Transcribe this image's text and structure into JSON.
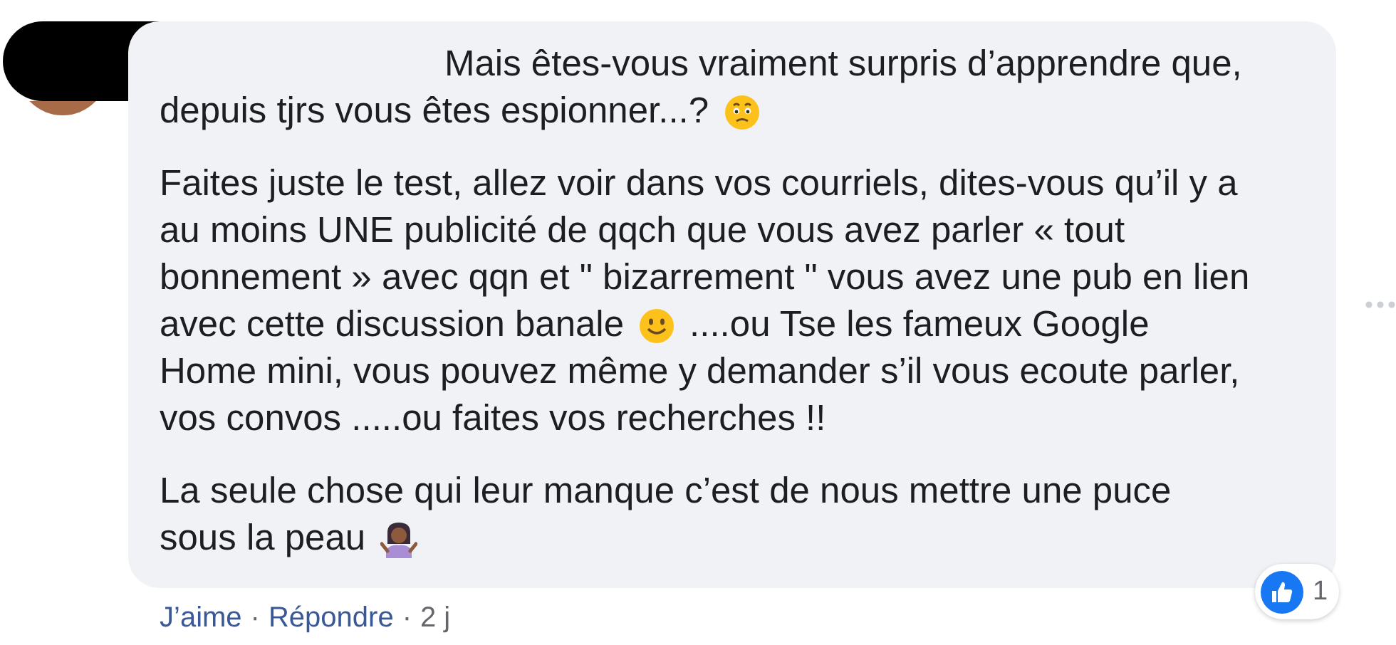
{
  "comment": {
    "paragraphs": [
      [
        [
          {
            "kind": "text",
            "text": "Mais êtes-vous vraiment surpris d’apprendre que,"
          }
        ],
        [
          {
            "kind": "text",
            "text": "depuis tjrs vous êtes espionner...?"
          },
          {
            "kind": "worried"
          }
        ]
      ],
      [
        [
          {
            "kind": "text",
            "text": "Faites juste le test, allez voir dans vos courriels, dites-vous qu’il y a"
          }
        ],
        [
          {
            "kind": "text",
            "text": "au moins UNE publicité de qqch que vous avez parler « tout"
          }
        ],
        [
          {
            "kind": "text",
            "text": "bonnement » avec qqn et \" bizarrement \" vous avez une pub en lien"
          }
        ],
        [
          {
            "kind": "text",
            "text": "avec cette discussion banale"
          },
          {
            "kind": "smiley"
          },
          {
            "kind": "text",
            "text": "....ou Tse les fameux Google"
          }
        ],
        [
          {
            "kind": "text",
            "text": "Home mini, vous pouvez même y demander s’il vous ecoute parler,"
          }
        ],
        [
          {
            "kind": "text",
            "text": "vos convos .....ou faites vos recherches !!"
          }
        ]
      ],
      [
        [
          {
            "kind": "text",
            "text": "La seule chose qui leur manque c’est de nous mettre une puce"
          }
        ],
        [
          {
            "kind": "text",
            "text": "sous la peau"
          },
          {
            "kind": "shrug"
          }
        ]
      ]
    ],
    "reaction_count": "1",
    "actions": [
      {
        "kind": "link",
        "text": "J’aime"
      },
      {
        "kind": "sep",
        "text": "·"
      },
      {
        "kind": "link",
        "text": "Répondre"
      },
      {
        "kind": "sep",
        "text": "·"
      },
      {
        "kind": "plain",
        "text": "2 j"
      }
    ]
  }
}
